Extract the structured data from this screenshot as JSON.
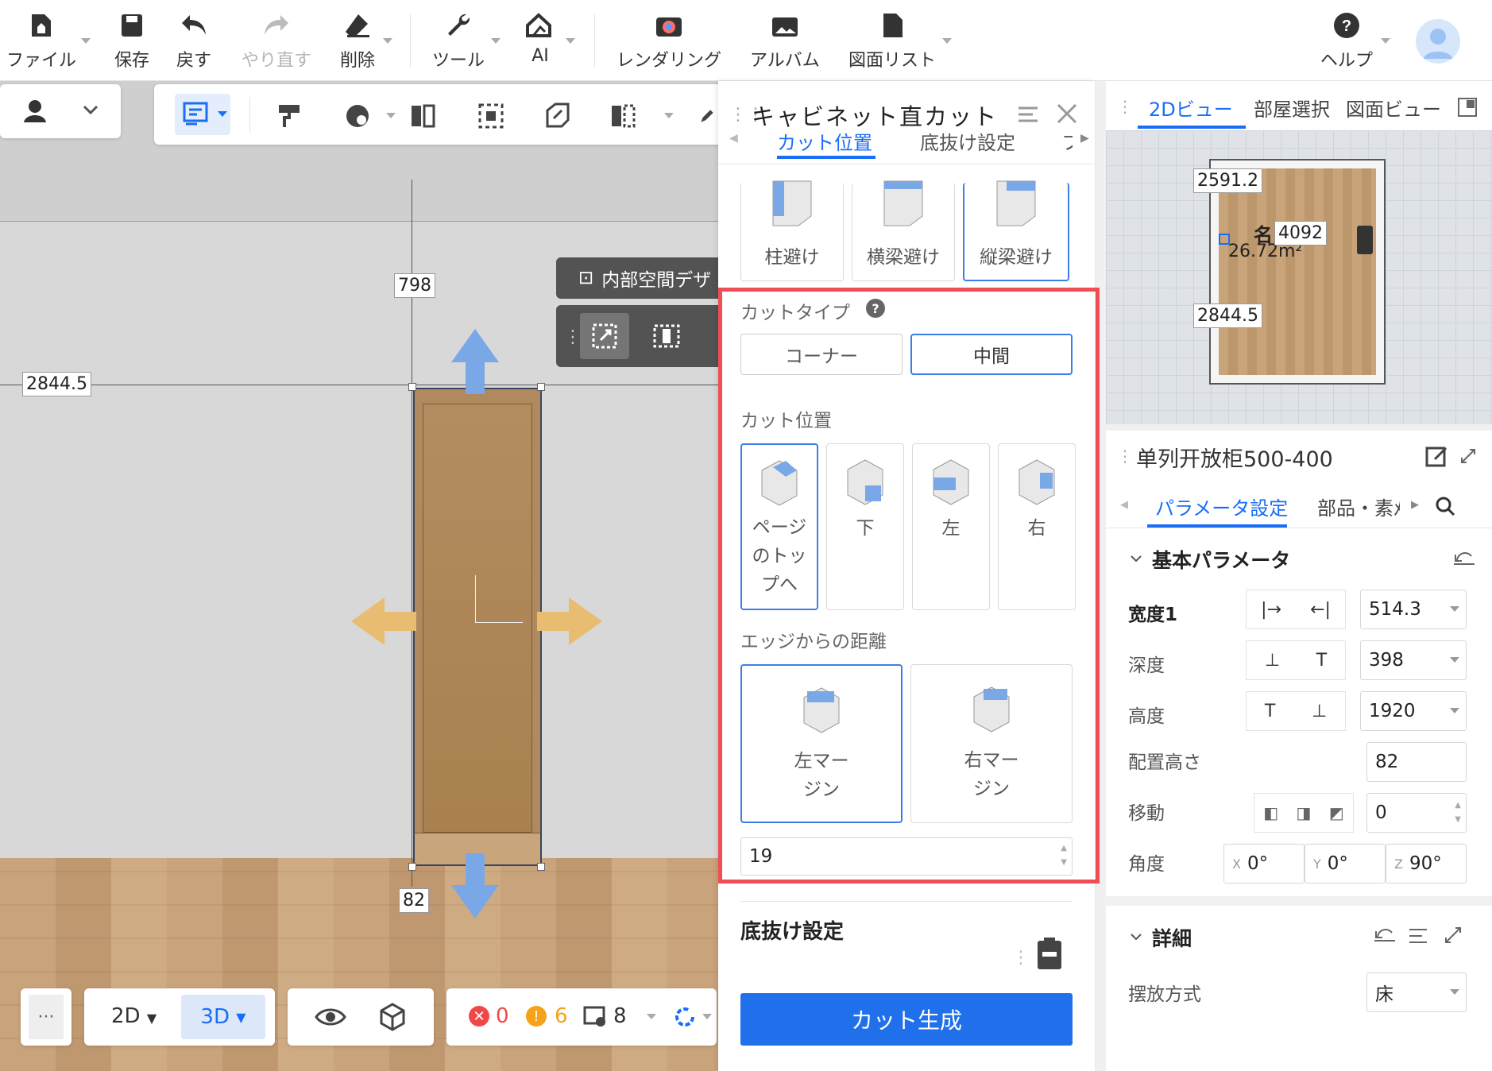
{
  "toolbar": {
    "file": "ファイル",
    "save": "保存",
    "undo": "戻す",
    "redo": "やり直す",
    "delete": "削除",
    "tools": "ツール",
    "ai": "AI",
    "render": "レンダリング",
    "album": "アルバム",
    "drawing_list": "図面リスト",
    "help": "ヘルプ"
  },
  "scene": {
    "dim_top": "798",
    "dim_left": "2844.5",
    "dim_bottom": "82",
    "interior_label": "内部空間デザ"
  },
  "bottom_bar": {
    "more": "···",
    "view_2d": "2D",
    "view_3d": "3D",
    "errors": "0",
    "warnings": "6",
    "notes": "8"
  },
  "cut_panel": {
    "title": "キャビネット直カット",
    "tabs": [
      "カット位置",
      "底抜け設定",
      "フ"
    ],
    "avoid_options": [
      "柱避け",
      "横梁避け",
      "縦梁避け"
    ],
    "cut_type_label": "カットタイプ",
    "cut_types": [
      "コーナー",
      "中間"
    ],
    "cut_position_label": "カット位置",
    "cut_positions": [
      {
        "label": "ページのトップへ",
        "lines": [
          "ページ",
          "のトッ",
          "プへ"
        ]
      },
      {
        "label": "下",
        "lines": [
          "下"
        ]
      },
      {
        "label": "左",
        "lines": [
          "左"
        ]
      },
      {
        "label": "右",
        "lines": [
          "右"
        ]
      }
    ],
    "edge_distance_label": "エッジからの距離",
    "margins": [
      {
        "lines": [
          "左マー",
          "ジン"
        ]
      },
      {
        "lines": [
          "右マー",
          "ジン"
        ]
      }
    ],
    "distance_value": "19",
    "bottom_section_title": "底抜け設定",
    "generate_button": "カット生成"
  },
  "view_panel": {
    "tabs": [
      "2Dビュー",
      "部屋選択",
      "図面ビュー"
    ],
    "dim_a": "2591.2",
    "dim_b": "4092",
    "dim_c": "2844.5",
    "label_name": "名",
    "label_area": "26.72m²"
  },
  "props_panel": {
    "title": "单列开放柜500-400",
    "tabs": [
      "パラメータ設定",
      "部品・素ﾒ"
    ],
    "section_basic": "基本パラメータ",
    "params": [
      {
        "label": "宽度1",
        "value": "514.3"
      },
      {
        "label": "深度",
        "value": "398"
      },
      {
        "label": "高度",
        "value": "1920"
      },
      {
        "label": "配置高さ",
        "value": "82"
      },
      {
        "label": "移動",
        "value": "0"
      }
    ],
    "angle_label": "角度",
    "angle_x_axis": "X",
    "angle_x": "0°",
    "angle_y_axis": "Y",
    "angle_y": "0°",
    "angle_z_axis": "Z",
    "angle_z": "90°",
    "section_detail": "詳細",
    "placement_label": "摆放方式",
    "placement_value": "床"
  }
}
